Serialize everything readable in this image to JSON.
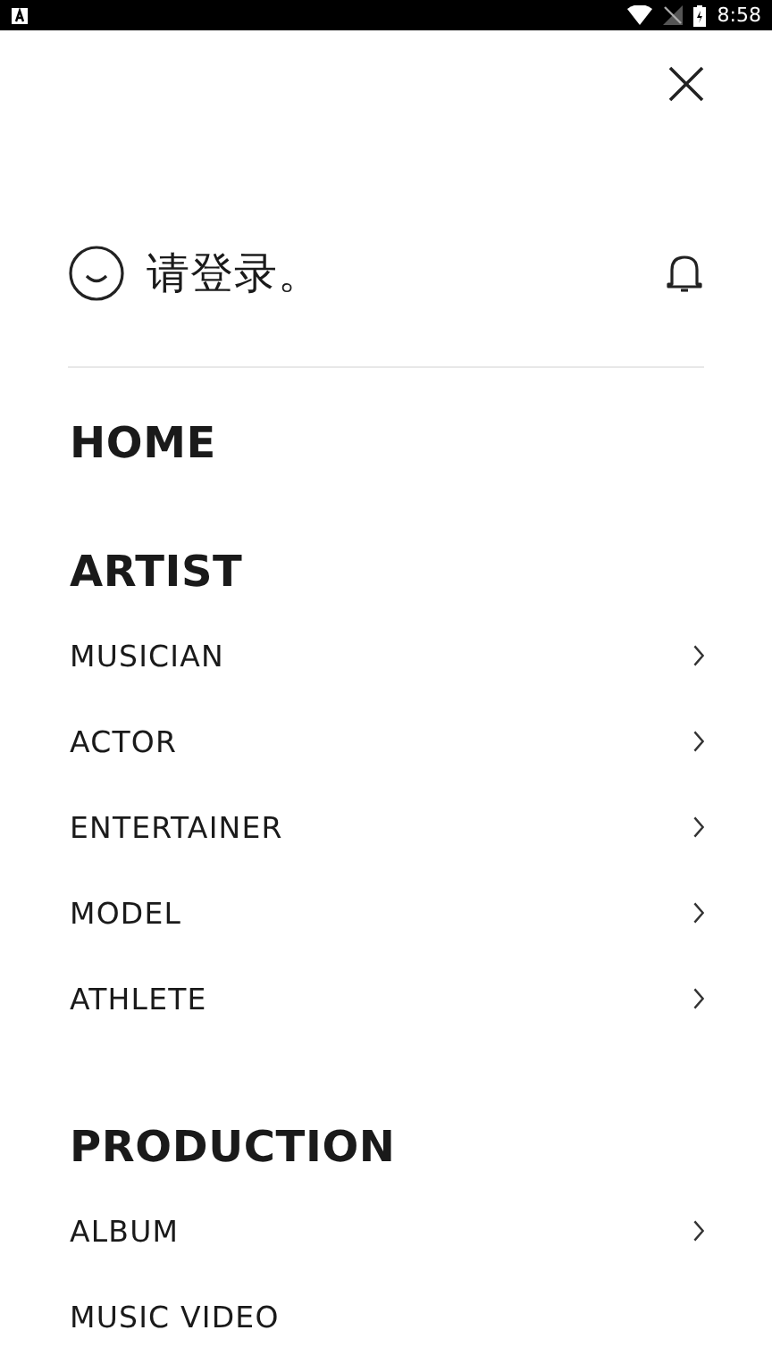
{
  "status_bar": {
    "time": "8:58"
  },
  "account": {
    "prompt": "请登录。"
  },
  "sections": [
    {
      "title": "HOME"
    },
    {
      "title": "ARTIST",
      "items": [
        {
          "label": "MUSICIAN",
          "chevron": true
        },
        {
          "label": "ACTOR",
          "chevron": true
        },
        {
          "label": "ENTERTAINER",
          "chevron": true
        },
        {
          "label": "MODEL",
          "chevron": true
        },
        {
          "label": "ATHLETE",
          "chevron": true
        }
      ]
    },
    {
      "title": "PRODUCTION",
      "items": [
        {
          "label": "ALBUM",
          "chevron": true
        },
        {
          "label": "MUSIC VIDEO",
          "chevron": false
        }
      ]
    }
  ]
}
